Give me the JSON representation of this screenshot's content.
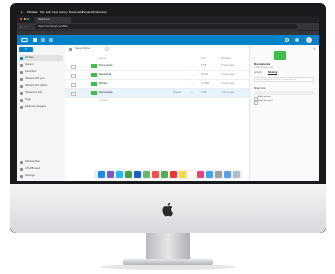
{
  "menubar": {
    "app_name": "Chrome",
    "menus": [
      "File",
      "Edit",
      "View",
      "History",
      "Bookmarks",
      "People",
      "Window",
      "Help"
    ]
  },
  "browser": {
    "tab_title": "Nextcloud",
    "url": "https://nextcloud.com/files"
  },
  "sidebar": {
    "items": [
      {
        "label": "All files",
        "icon": "folder-icon",
        "active": true
      },
      {
        "label": "Recent",
        "icon": "clock-icon",
        "active": false
      },
      {
        "label": "Favorites",
        "icon": "star-icon",
        "active": false
      },
      {
        "label": "Shared with you",
        "icon": "share-icon",
        "active": false
      },
      {
        "label": "Shared with others",
        "icon": "share-icon",
        "active": false
      },
      {
        "label": "Shared by link",
        "icon": "link-icon",
        "active": false
      },
      {
        "label": "Tags",
        "icon": "tag-icon",
        "active": false
      },
      {
        "label": "External storages",
        "icon": "hdd-icon",
        "active": false
      }
    ],
    "bottom_items": [
      {
        "label": "Deleted files",
        "icon": "trash-icon"
      },
      {
        "label": "3.6 MB used",
        "icon": "chart-icon"
      },
      {
        "label": "Settings",
        "icon": "gear-icon"
      }
    ]
  },
  "main": {
    "breadcrumb": "Neue Ordner",
    "columns": {
      "name": "Name",
      "size": "Size",
      "modified": "Modified"
    },
    "files": [
      {
        "name": "Documents",
        "size": "8 KB",
        "modified": "3 hours ago",
        "selected": false
      },
      {
        "name": "Nextcloud",
        "size": "33 KB",
        "modified": "3 hours ago",
        "selected": false
      },
      {
        "name": "Photos",
        "size": "2.2 MB",
        "modified": "3 hours ago",
        "selected": false
      },
      {
        "name": "Documents",
        "size": "0 KB",
        "modified": "3 hours ago",
        "selected": true,
        "action": "Shared"
      }
    ],
    "summary": "4 folders"
  },
  "details": {
    "title": "Documents",
    "meta": "0 KB, 3 hours ago",
    "tabs": [
      "Activity",
      "Sharing"
    ],
    "share_placeholder": "Name, federated cloud ID or email address…",
    "section_label": "Share link",
    "items": [
      "Allow editing",
      "Hide download"
    ]
  },
  "dock": {
    "icons": [
      "finder-icon",
      "launchpad-icon",
      "safari-icon",
      "chrome-icon",
      "mail-icon",
      "maps-icon",
      "photos-icon",
      "messages-icon",
      "calendar-icon",
      "notes-icon",
      "reminders-icon",
      "music-icon",
      "appstore-icon",
      "settings-icon",
      "folder-icon",
      "trash-icon"
    ],
    "colors": [
      "#1e88e5",
      "#7e57c2",
      "#29b6f6",
      "#43a047",
      "#1565c0",
      "#66bb6a",
      "#ef5350",
      "#4caf50",
      "#e53935",
      "#fdd835",
      "#ffffff",
      "#ec407a",
      "#42a5f5",
      "#9e9e9e",
      "#5c9ce6",
      "#b0bec5"
    ]
  },
  "colors": {
    "accent": "#0082c9",
    "folder": "#3fbf49"
  }
}
